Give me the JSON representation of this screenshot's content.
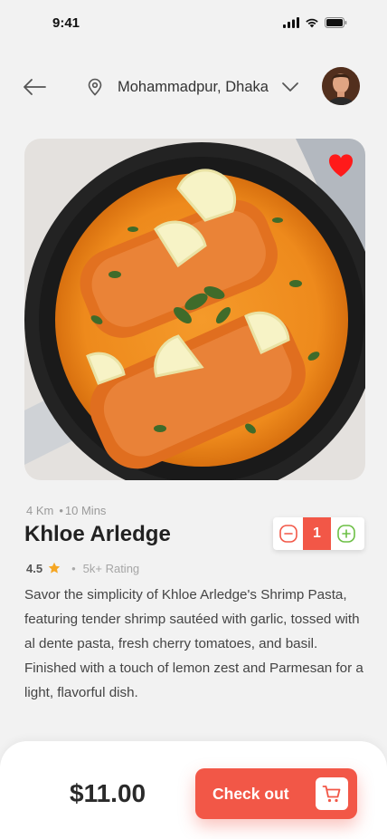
{
  "status_bar": {
    "time": "9:41"
  },
  "header": {
    "location": "Mohammadpur, Dhaka"
  },
  "icons": {
    "back": "back-arrow-icon",
    "location": "map-pin-icon",
    "chevron": "chevron-down-icon",
    "favorite": "heart-icon",
    "minus": "minus-icon",
    "plus": "plus-icon",
    "star": "star-icon",
    "cart": "cart-icon"
  },
  "colors": {
    "accent": "#f25747",
    "favorite": "#ff1a1a",
    "star": "#f5a623",
    "plus": "#6cbf45"
  },
  "product": {
    "distance": "4 Km",
    "time": "10 Mins",
    "name": "Khloe Arledge",
    "quantity": "1",
    "rating": "4.5",
    "rating_count": "5k+ Rating",
    "description": "Savor the simplicity of Khloe Arledge's Shrimp Pasta, featuring tender shrimp sautéed with garlic, tossed with al dente pasta, fresh cherry tomatoes, and basil. Finished with a touch of lemon zest and Parmesan for a light, flavorful dish."
  },
  "checkout": {
    "price": "$11.00",
    "label": "Check out"
  }
}
